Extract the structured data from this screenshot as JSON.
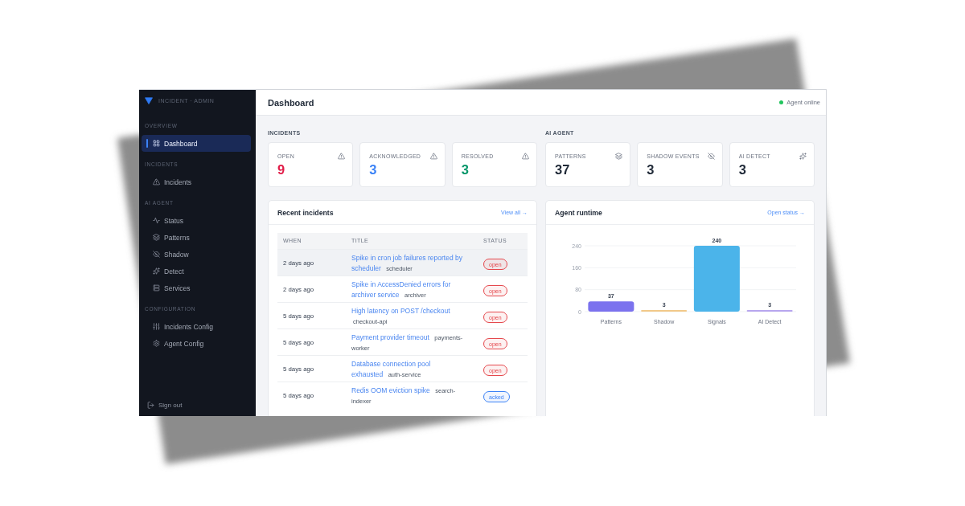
{
  "sidebar": {
    "brand": "INCIDENT · ADMIN",
    "groups": [
      {
        "label": "OVERVIEW",
        "items": [
          {
            "label": "Dashboard",
            "selected": true
          }
        ]
      },
      {
        "label": "INCIDENTS",
        "items": [
          {
            "label": "Incidents",
            "selected": false
          }
        ]
      },
      {
        "label": "AI AGENT",
        "items": [
          {
            "label": "Status",
            "selected": false
          },
          {
            "label": "Patterns",
            "selected": false
          },
          {
            "label": "Shadow",
            "selected": false
          },
          {
            "label": "Detect",
            "selected": false
          },
          {
            "label": "Services",
            "selected": false
          }
        ]
      },
      {
        "label": "CONFIGURATION",
        "items": [
          {
            "label": "Incidents Config",
            "selected": false
          },
          {
            "label": "Agent Config",
            "selected": false
          }
        ]
      }
    ],
    "sign_out": "Sign out"
  },
  "header": {
    "title": "Dashboard",
    "agent_status": {
      "label": "Agent online",
      "online": true
    }
  },
  "stat_groups": [
    {
      "label": "INCIDENTS",
      "cards": [
        {
          "label": "OPEN",
          "value": "9",
          "color": "#e11d48"
        },
        {
          "label": "ACKNOWLEDGED",
          "value": "3",
          "color": "#3b82f6"
        },
        {
          "label": "RESOLVED",
          "value": "3",
          "color": "#059669"
        }
      ]
    },
    {
      "label": "AI AGENT",
      "cards": [
        {
          "label": "PATTERNS",
          "value": "37",
          "color": "#1f2937"
        },
        {
          "label": "SHADOW EVENTS",
          "value": "3",
          "color": "#1f2937"
        },
        {
          "label": "AI DETECT",
          "value": "3",
          "color": "#1f2937"
        }
      ]
    }
  ],
  "recent_incidents": {
    "title": "Recent incidents",
    "link": "View all →",
    "columns": [
      "WHEN",
      "TITLE",
      "STATUS"
    ],
    "rows": [
      {
        "when": "2 days ago",
        "title": "Spike in cron job failures reported by scheduler",
        "service": "scheduler",
        "status": {
          "label": "open",
          "color": "#e5484d"
        },
        "highlighted": true
      },
      {
        "when": "2 days ago",
        "title": "Spike in AccessDenied errors for archiver service",
        "service": "archiver",
        "status": {
          "label": "open",
          "color": "#e5484d"
        },
        "highlighted": false
      },
      {
        "when": "5 days ago",
        "title": "High latency on POST /checkout",
        "service": "checkout-api",
        "status": {
          "label": "open",
          "color": "#e5484d"
        },
        "highlighted": false
      },
      {
        "when": "5 days ago",
        "title": "Payment provider timeout",
        "service": "payments-worker",
        "status": {
          "label": "open",
          "color": "#e5484d"
        },
        "highlighted": false
      },
      {
        "when": "5 days ago",
        "title": "Database connection pool exhausted",
        "service": "auth-service",
        "status": {
          "label": "open",
          "color": "#e5484d"
        },
        "highlighted": false
      },
      {
        "when": "5 days ago",
        "title": "Redis OOM eviction spike",
        "service": "search-indexer",
        "status": {
          "label": "acked",
          "color": "#3b82f6"
        },
        "highlighted": false
      }
    ]
  },
  "agent_runtime": {
    "title": "Agent runtime",
    "link": "Open status →",
    "chart_data": {
      "type": "bar",
      "categories": [
        "Patterns",
        "Shadow",
        "Signals",
        "AI Detect"
      ],
      "values": [
        37,
        3,
        240,
        3
      ],
      "colors": [
        "#7b72ee",
        "#f2c98a",
        "#4bb4ea",
        "#b8a7ef"
      ],
      "ylim": [
        0,
        240
      ],
      "yticks": [
        0,
        80,
        160,
        240
      ],
      "data_labels": true
    }
  }
}
